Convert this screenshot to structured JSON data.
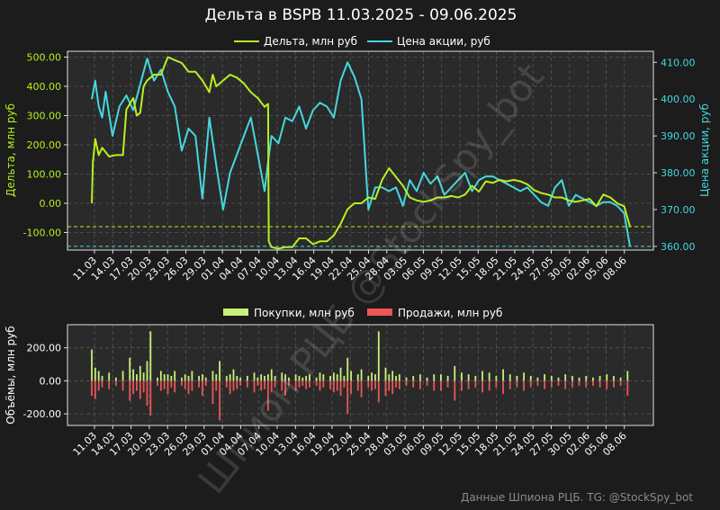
{
  "title": "Дельта в BSPB 11.03.2025 - 09.06.2025",
  "footer": "Данные Шпиона РЦБ. TG: @StockSpy_bot",
  "watermark": "Шпион РЦБ @StockSpy_bot",
  "colors": {
    "background": "#1c1c1c",
    "plot_bg": "#2a2a2a",
    "delta": "#b8f020",
    "price": "#45d7de",
    "buy": "#c8f07a",
    "sell": "#ec5656"
  },
  "chart_data": [
    {
      "type": "line",
      "title": "Дельта в BSPB 11.03.2025 - 09.06.2025",
      "xlabel": "",
      "ylabel": "Дельта, млн руб",
      "ylabel_right": "Цена акции, руб",
      "x_ticks": [
        "11.03",
        "14.03",
        "17.03",
        "20.03",
        "23.03",
        "26.03",
        "29.03",
        "01.04",
        "04.04",
        "07.04",
        "10.04",
        "13.04",
        "16.04",
        "19.04",
        "22.04",
        "25.04",
        "28.04",
        "03.05",
        "06.05",
        "09.05",
        "12.05",
        "15.05",
        "18.05",
        "21.05",
        "24.05",
        "27.05",
        "30.05",
        "02.06",
        "05.06",
        "08.06"
      ],
      "y_ticks": [
        "500.00",
        "400.00",
        "300.00",
        "200.00",
        "100.00",
        "0.00",
        "-100.00"
      ],
      "y_ticks_right": [
        "410.00",
        "400.00",
        "390.00",
        "380.00",
        "370.00",
        "360.00"
      ],
      "ylim": [
        -160,
        520
      ],
      "ylim_right": [
        359,
        413
      ],
      "legend": "top-center",
      "grid": true,
      "series": [
        {
          "name": "Дельта, млн руб",
          "axis": "left",
          "x": [
            0,
            0.3,
            1,
            2,
            3,
            5,
            7,
            9,
            10,
            11,
            12,
            13,
            14,
            15,
            16,
            17,
            18,
            20,
            22,
            24,
            26,
            28,
            30,
            32,
            34,
            35,
            36,
            38,
            40,
            42,
            44,
            46,
            48,
            50,
            51,
            51.2,
            52,
            54,
            56,
            58,
            60,
            62,
            64,
            66,
            68,
            70,
            72,
            74,
            76,
            78,
            80,
            82,
            84,
            86,
            88,
            90,
            92,
            94,
            96,
            98,
            100,
            102,
            104,
            106,
            108,
            110,
            112,
            114,
            116,
            118,
            120,
            122,
            124,
            126,
            128,
            130,
            132,
            134,
            136,
            138,
            140,
            142,
            144,
            146,
            148,
            150,
            152,
            154,
            155.7
          ],
          "values": [
            0,
            140,
            220,
            165,
            190,
            160,
            165,
            165,
            320,
            340,
            360,
            300,
            310,
            400,
            420,
            430,
            440,
            440,
            500,
            490,
            480,
            450,
            450,
            420,
            380,
            440,
            400,
            420,
            440,
            430,
            410,
            380,
            360,
            330,
            340,
            -130,
            -150,
            -155,
            -150,
            -150,
            -120,
            -120,
            -140,
            -130,
            -130,
            -110,
            -70,
            -20,
            0,
            0,
            20,
            15,
            80,
            120,
            90,
            60,
            20,
            10,
            5,
            10,
            20,
            20,
            25,
            20,
            30,
            60,
            40,
            75,
            70,
            80,
            75,
            80,
            75,
            65,
            45,
            35,
            30,
            20,
            20,
            10,
            5,
            10,
            15,
            -10,
            30,
            20,
            0,
            -10,
            -80
          ]
        },
        {
          "name": "Цена акции, руб",
          "axis": "right",
          "x": [
            0,
            1,
            2,
            3,
            4,
            6,
            8,
            10,
            12,
            14,
            16,
            18,
            20,
            22,
            24,
            26,
            28,
            30,
            32,
            34,
            36,
            38,
            40,
            42,
            44,
            46,
            48,
            50,
            51,
            52,
            54,
            56,
            58,
            60,
            62,
            64,
            66,
            68,
            70,
            72,
            74,
            76,
            78,
            80,
            82,
            84,
            86,
            88,
            90,
            92,
            94,
            96,
            98,
            100,
            102,
            104,
            106,
            108,
            110,
            112,
            114,
            116,
            118,
            120,
            122,
            124,
            126,
            128,
            130,
            132,
            134,
            136,
            138,
            140,
            142,
            144,
            146,
            148,
            150,
            152,
            154,
            155.7
          ],
          "values": [
            400,
            405,
            398,
            395,
            402,
            390,
            398,
            401,
            397,
            404,
            411,
            405,
            408,
            402,
            398,
            386,
            392,
            390,
            373,
            395,
            382,
            370,
            380,
            385,
            390,
            395,
            385,
            375,
            383,
            390,
            388,
            395,
            394,
            398,
            392,
            397,
            399,
            398,
            395,
            405,
            410,
            406,
            400,
            370,
            376,
            376,
            375,
            376,
            371,
            378,
            375,
            380,
            377,
            379,
            374,
            376,
            378,
            380,
            375,
            378,
            379,
            379,
            378,
            377,
            376,
            375,
            376,
            374,
            372,
            371,
            376,
            378,
            371,
            374,
            373,
            372,
            371,
            372,
            372,
            371,
            369,
            360
          ]
        }
      ]
    },
    {
      "type": "bar",
      "title": "",
      "xlabel": "",
      "ylabel": "Объёмы, млн руб",
      "x_ticks": [
        "11.03",
        "14.03",
        "17.03",
        "20.03",
        "23.03",
        "26.03",
        "29.03",
        "01.04",
        "04.04",
        "07.04",
        "10.04",
        "13.04",
        "16.04",
        "19.04",
        "22.04",
        "25.04",
        "28.04",
        "03.05",
        "06.05",
        "09.05",
        "12.05",
        "15.05",
        "18.05",
        "21.05",
        "24.05",
        "27.05",
        "30.05",
        "02.06",
        "05.06",
        "08.06"
      ],
      "y_ticks": [
        "200.00",
        "0.00",
        "-200.00"
      ],
      "ylim": [
        -270,
        340
      ],
      "legend": "top-center",
      "grid": true,
      "series": [
        {
          "name": "Покупки, млн руб",
          "x": [
            0,
            1,
            2,
            3,
            5,
            7,
            9,
            11,
            12,
            13,
            14,
            15,
            16,
            17,
            19,
            20,
            21,
            22,
            23,
            24,
            26,
            27,
            28,
            29,
            31,
            32,
            33,
            35,
            36,
            37,
            39,
            40,
            41,
            42,
            43,
            45,
            47,
            48,
            49,
            50,
            51,
            52,
            53,
            55,
            56,
            57,
            59,
            60,
            61,
            62,
            63,
            65,
            66,
            67,
            69,
            70,
            71,
            72,
            73,
            74,
            75,
            77,
            78,
            80,
            81,
            82,
            83,
            85,
            86,
            87,
            88,
            89,
            91,
            93,
            95,
            97,
            99,
            101,
            103,
            105,
            107,
            109,
            111,
            113,
            115,
            117,
            119,
            121,
            123,
            125,
            127,
            129,
            131,
            133,
            135,
            137,
            139,
            141,
            143,
            145,
            147,
            149,
            151,
            153,
            155
          ],
          "values": [
            190,
            80,
            60,
            30,
            50,
            20,
            60,
            140,
            70,
            40,
            90,
            50,
            120,
            300,
            20,
            60,
            40,
            40,
            30,
            60,
            20,
            40,
            30,
            60,
            30,
            40,
            20,
            60,
            40,
            120,
            30,
            40,
            70,
            30,
            20,
            30,
            50,
            20,
            40,
            30,
            40,
            70,
            30,
            50,
            40,
            20,
            40,
            30,
            20,
            30,
            40,
            20,
            50,
            40,
            30,
            50,
            40,
            80,
            30,
            140,
            60,
            40,
            70,
            30,
            50,
            40,
            300,
            80,
            40,
            60,
            30,
            40,
            20,
            30,
            40,
            20,
            40,
            40,
            30,
            90,
            50,
            40,
            30,
            60,
            50,
            30,
            70,
            40,
            30,
            50,
            30,
            20,
            40,
            30,
            20,
            40,
            30,
            20,
            30,
            20,
            30,
            40,
            30,
            20,
            60
          ]
        },
        {
          "name": "Продажи, млн руб",
          "x": [
            0,
            1,
            2,
            3,
            5,
            7,
            9,
            11,
            12,
            13,
            14,
            15,
            16,
            17,
            19,
            20,
            21,
            22,
            23,
            24,
            26,
            27,
            28,
            29,
            31,
            32,
            33,
            35,
            36,
            37,
            39,
            40,
            41,
            42,
            43,
            45,
            47,
            48,
            49,
            50,
            51,
            52,
            53,
            55,
            56,
            57,
            59,
            60,
            61,
            62,
            63,
            65,
            66,
            67,
            69,
            70,
            71,
            72,
            73,
            74,
            75,
            77,
            78,
            80,
            81,
            82,
            83,
            85,
            86,
            87,
            88,
            89,
            91,
            93,
            95,
            97,
            99,
            101,
            103,
            105,
            107,
            109,
            111,
            113,
            115,
            117,
            119,
            121,
            123,
            125,
            127,
            129,
            131,
            133,
            135,
            137,
            139,
            141,
            143,
            145,
            147,
            149,
            151,
            153,
            155
          ],
          "values": [
            -90,
            -110,
            -60,
            -40,
            -50,
            -30,
            -60,
            -120,
            -80,
            -60,
            -110,
            -70,
            -150,
            -210,
            -30,
            -60,
            -50,
            -80,
            -40,
            -70,
            -30,
            -50,
            -80,
            -60,
            -40,
            -90,
            -30,
            -140,
            -60,
            -240,
            -40,
            -80,
            -60,
            -50,
            -30,
            -40,
            -70,
            -30,
            -60,
            -50,
            -180,
            -70,
            -40,
            -60,
            -90,
            -30,
            -60,
            -40,
            -30,
            -50,
            -40,
            -30,
            -60,
            -40,
            -50,
            -70,
            -60,
            -90,
            -40,
            -200,
            -80,
            -60,
            -100,
            -40,
            -60,
            -50,
            -130,
            -90,
            -60,
            -80,
            -40,
            -50,
            -30,
            -40,
            -50,
            -30,
            -60,
            -60,
            -40,
            -120,
            -60,
            -50,
            -40,
            -70,
            -60,
            -40,
            -80,
            -50,
            -40,
            -60,
            -40,
            -30,
            -50,
            -40,
            -30,
            -50,
            -40,
            -30,
            -40,
            -30,
            -40,
            -50,
            -40,
            -30,
            -90
          ]
        }
      ]
    }
  ]
}
